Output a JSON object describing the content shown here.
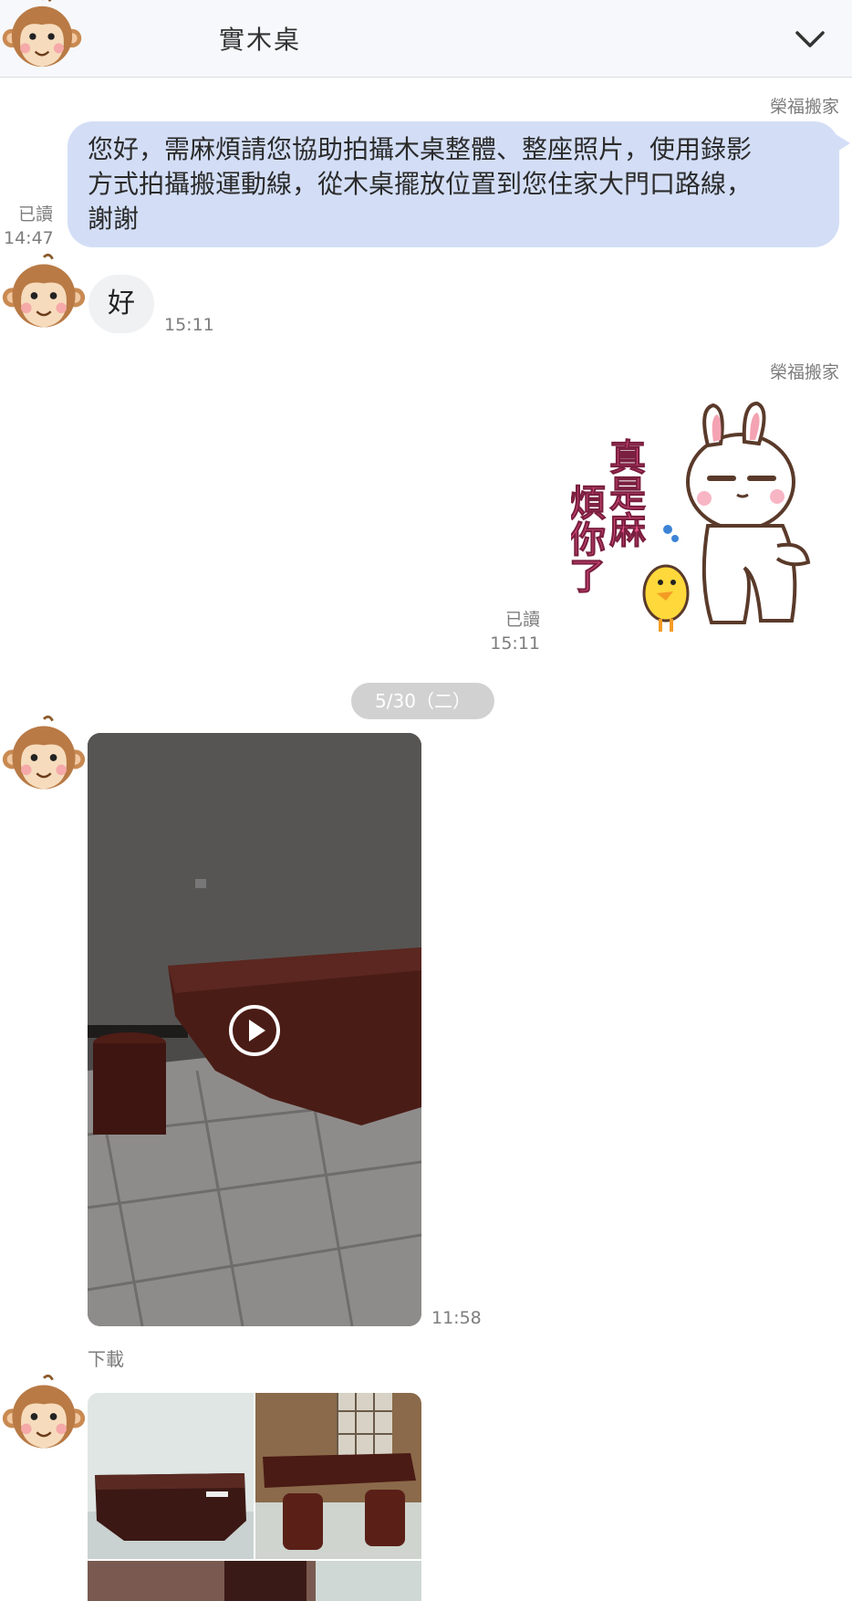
{
  "header": {
    "title": "實木桌",
    "menu_icon": "chevron-down-icon"
  },
  "messages": {
    "out1": {
      "sender": "榮福搬家",
      "lines": [
        "您好，需麻煩請您協助拍攝木桌整體、整座照片，使用錄影",
        "方式拍攝搬運動線，從木桌擺放位置到您住家大門口路線，",
        "謝謝"
      ],
      "read": "已讀",
      "time": "14:47"
    },
    "in1": {
      "text": "好",
      "time": "15:11"
    },
    "out2": {
      "sender": "榮福搬家",
      "sticker_text": [
        "真是麻",
        "煩你了"
      ],
      "read": "已讀",
      "time": "15:11"
    },
    "date_divider": "5/30（二）",
    "in2": {
      "type": "video",
      "time": "11:58",
      "download_label": "下載"
    }
  },
  "colors": {
    "outgoing_bubble": "#d3def6",
    "incoming_bubble": "#f0f1f3",
    "date_pill": "#d1d1d1",
    "meta_text": "#7d7d7d"
  }
}
